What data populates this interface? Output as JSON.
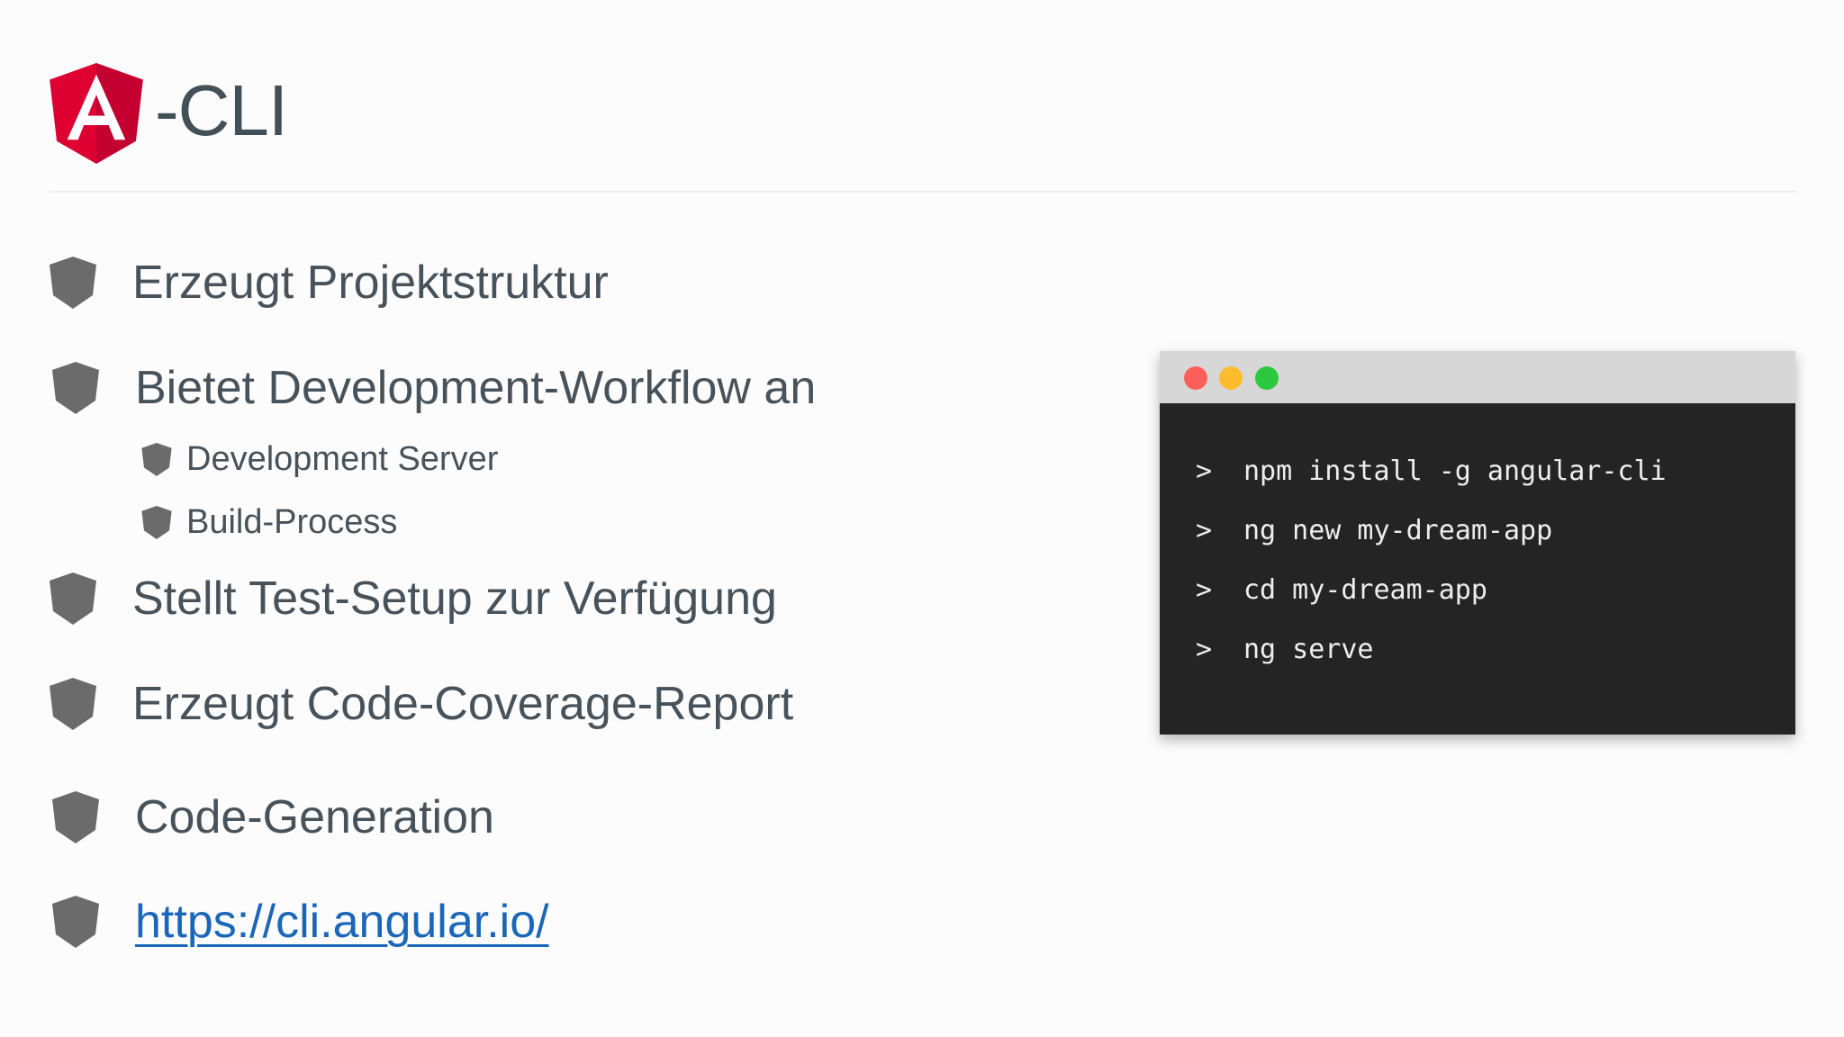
{
  "header": {
    "logo_letter": "A",
    "title": "-CLI",
    "brand_colors": {
      "logo_left": "#dd0031",
      "logo_right": "#c3002f",
      "letter": "#ffffff"
    }
  },
  "bullets": [
    {
      "label": "Erzeugt Projektstruktur",
      "level": 1
    },
    {
      "label": "Bietet Development-Workflow an",
      "level": 1
    },
    {
      "label": "Development Server",
      "level": 2
    },
    {
      "label": "Build-Process",
      "level": 2
    },
    {
      "label": "Stellt Test-Setup zur Verfügung",
      "level": 1
    },
    {
      "label": "Erzeugt Code-Coverage-Report",
      "level": 1
    },
    {
      "label": "Code-Generation",
      "level": 1
    },
    {
      "label": "https://cli.angular.io/",
      "level": 1,
      "is_link": true
    }
  ],
  "terminal": {
    "window_buttons": [
      "close",
      "minimize",
      "maximize"
    ],
    "colors": {
      "close": "#fc5f57",
      "minimize": "#fdbc2e",
      "maximize": "#2bc840",
      "background": "#242424",
      "titlebar": "#d7d7d7"
    },
    "lines": [
      {
        "prompt": ">",
        "command": "npm install -g angular-cli"
      },
      {
        "prompt": ">",
        "command": "ng new my-dream-app"
      },
      {
        "prompt": ">",
        "command": "cd my-dream-app"
      },
      {
        "prompt": ">",
        "command": "ng serve"
      }
    ]
  },
  "icons": {
    "bullet": "shield-icon",
    "logo": "angular-logo-icon"
  }
}
